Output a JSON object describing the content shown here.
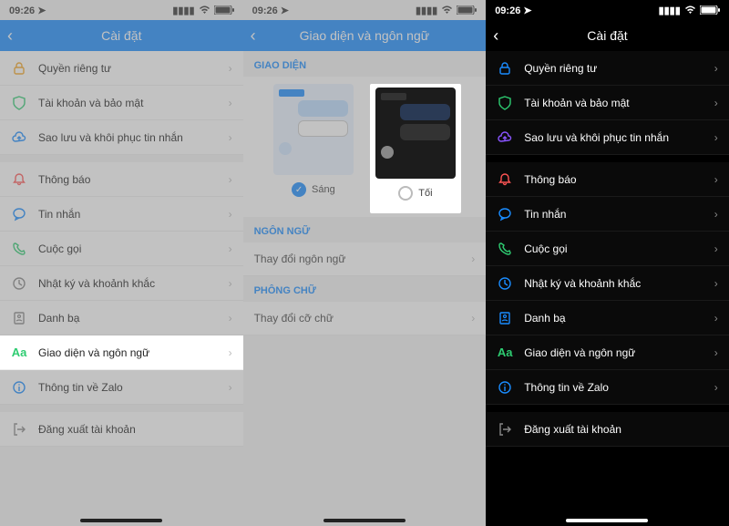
{
  "status": {
    "time": "09:26",
    "loc_icon": "location-arrow",
    "signal": "signal-icon",
    "wifi": "wifi-icon",
    "battery": "battery-icon"
  },
  "p1": {
    "title": "Cài đặt",
    "items": [
      {
        "icon": "lock",
        "color": "#f5a623",
        "label": "Quyền riêng tư"
      },
      {
        "icon": "shield",
        "color": "#2ecc71",
        "label": "Tài khoản và bảo mật"
      },
      {
        "icon": "cloud",
        "color": "#1a8cff",
        "label": "Sao lưu và khôi phục tin nhắn"
      },
      {
        "gap": true,
        "icon": "bell",
        "color": "#ff5555",
        "label": "Thông báo"
      },
      {
        "icon": "chat",
        "color": "#1a8cff",
        "label": "Tin nhắn"
      },
      {
        "icon": "phone",
        "color": "#2ecc71",
        "label": "Cuộc gọi"
      },
      {
        "icon": "clock",
        "color": "#888",
        "label": "Nhật ký và khoảnh khắc"
      },
      {
        "icon": "book",
        "color": "#888",
        "label": "Danh bạ"
      },
      {
        "icon": "Aa",
        "color": "#2ecc71",
        "label": "Giao diện và ngôn ngữ",
        "highlight": true
      },
      {
        "icon": "info",
        "color": "#1a8cff",
        "label": "Thông tin về Zalo"
      },
      {
        "gap": true,
        "icon": "logout",
        "color": "#888",
        "label": "Đăng xuất tài khoản",
        "nochev": true
      }
    ]
  },
  "p2": {
    "title": "Giao diện và ngôn ngữ",
    "sec_theme": "GIAO DIỆN",
    "theme_light": "Sáng",
    "theme_dark": "Tối",
    "sec_lang": "NGÔN NGỮ",
    "lang_row": "Thay đổi ngôn ngữ",
    "sec_font": "PHÔNG CHỮ",
    "font_row": "Thay đổi cỡ chữ"
  },
  "p3": {
    "title": "Cài đặt",
    "items": [
      {
        "icon": "lock",
        "color": "#1a8cff",
        "label": "Quyền riêng tư"
      },
      {
        "icon": "shield",
        "color": "#2ecc71",
        "label": "Tài khoản và bảo mật"
      },
      {
        "icon": "cloud",
        "color": "#8a55ff",
        "label": "Sao lưu và khôi phục tin nhắn"
      },
      {
        "gap": true,
        "icon": "bell",
        "color": "#ff5555",
        "label": "Thông báo"
      },
      {
        "icon": "chat",
        "color": "#1a8cff",
        "label": "Tin nhắn"
      },
      {
        "icon": "phone",
        "color": "#2ecc71",
        "label": "Cuộc gọi"
      },
      {
        "icon": "clock",
        "color": "#1a8cff",
        "label": "Nhật ký và khoảnh khắc"
      },
      {
        "icon": "book",
        "color": "#1a8cff",
        "label": "Danh bạ"
      },
      {
        "icon": "Aa",
        "color": "#2ecc71",
        "label": "Giao diện và ngôn ngữ"
      },
      {
        "icon": "info",
        "color": "#1a8cff",
        "label": "Thông tin về Zalo"
      },
      {
        "gap": true,
        "icon": "logout",
        "color": "#888",
        "label": "Đăng xuất tài khoản",
        "nochev": true
      }
    ]
  }
}
